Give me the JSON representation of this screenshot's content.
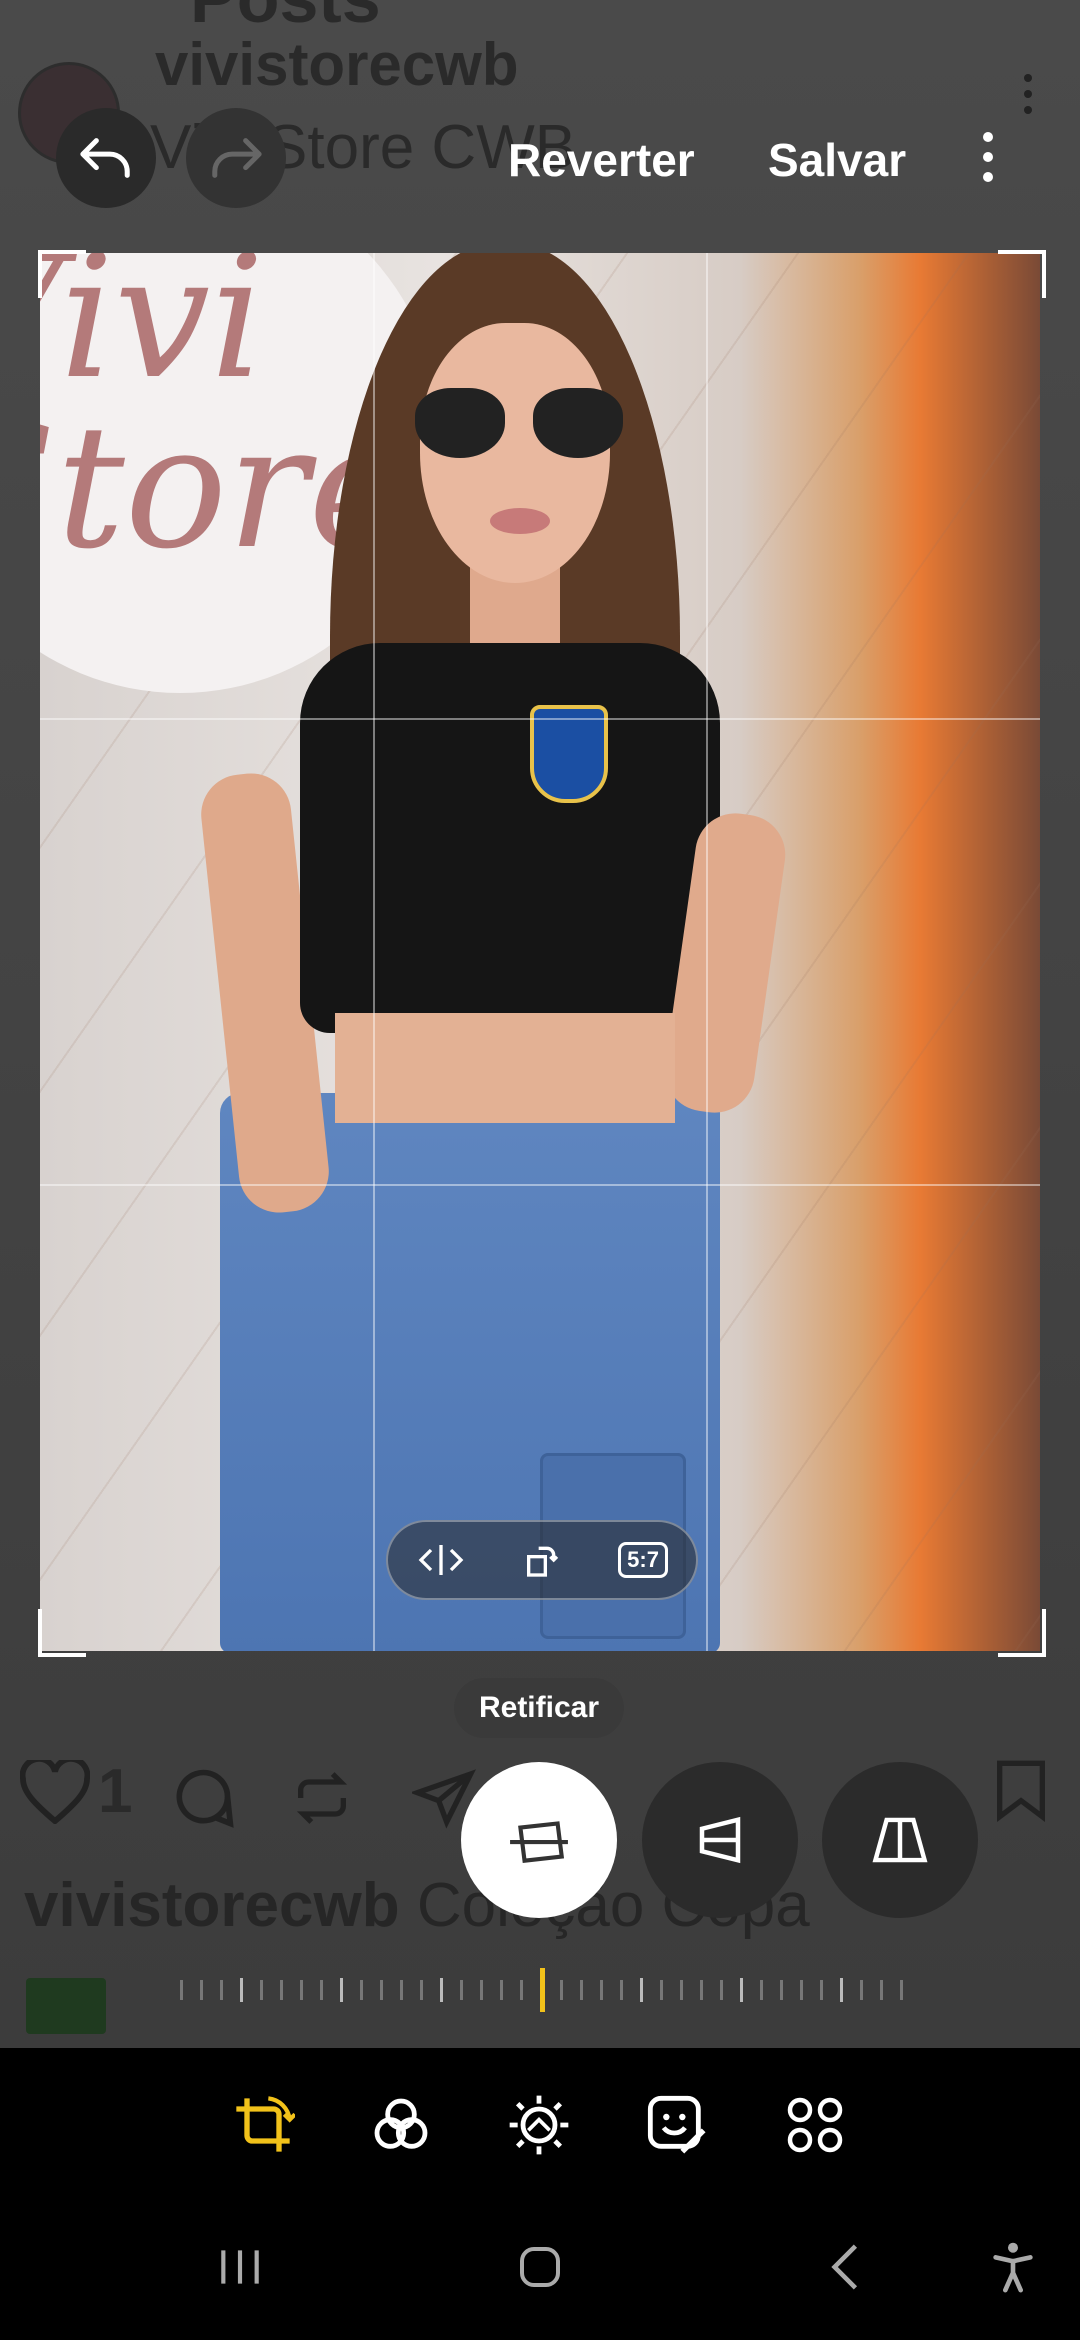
{
  "background": {
    "posts_title": "Posts",
    "store_handle": "vivistorecwb",
    "store_name": "Vivi Store CWB",
    "like_count": "1",
    "caption_user": "vivistorecwb",
    "caption_text": "Coleção Copa"
  },
  "toolbar": {
    "revert_label": "Reverter",
    "save_label": "Salvar"
  },
  "photo": {
    "sign_text": "Vivi Store"
  },
  "crop_controls": {
    "aspect_ratio": "5:7"
  },
  "transform": {
    "tooltip": "Retificar",
    "buttons": [
      "straighten",
      "vertical-perspective",
      "horizontal-perspective"
    ],
    "selected": "straighten",
    "slider_value": 0
  },
  "bottom_tabs": [
    "crop",
    "filters",
    "adjust",
    "stickers",
    "more"
  ],
  "bottom_tabs_selected": "crop",
  "colors": {
    "accent": "#f2c21a",
    "background": "#000000",
    "panel": "#3c3c3c"
  }
}
